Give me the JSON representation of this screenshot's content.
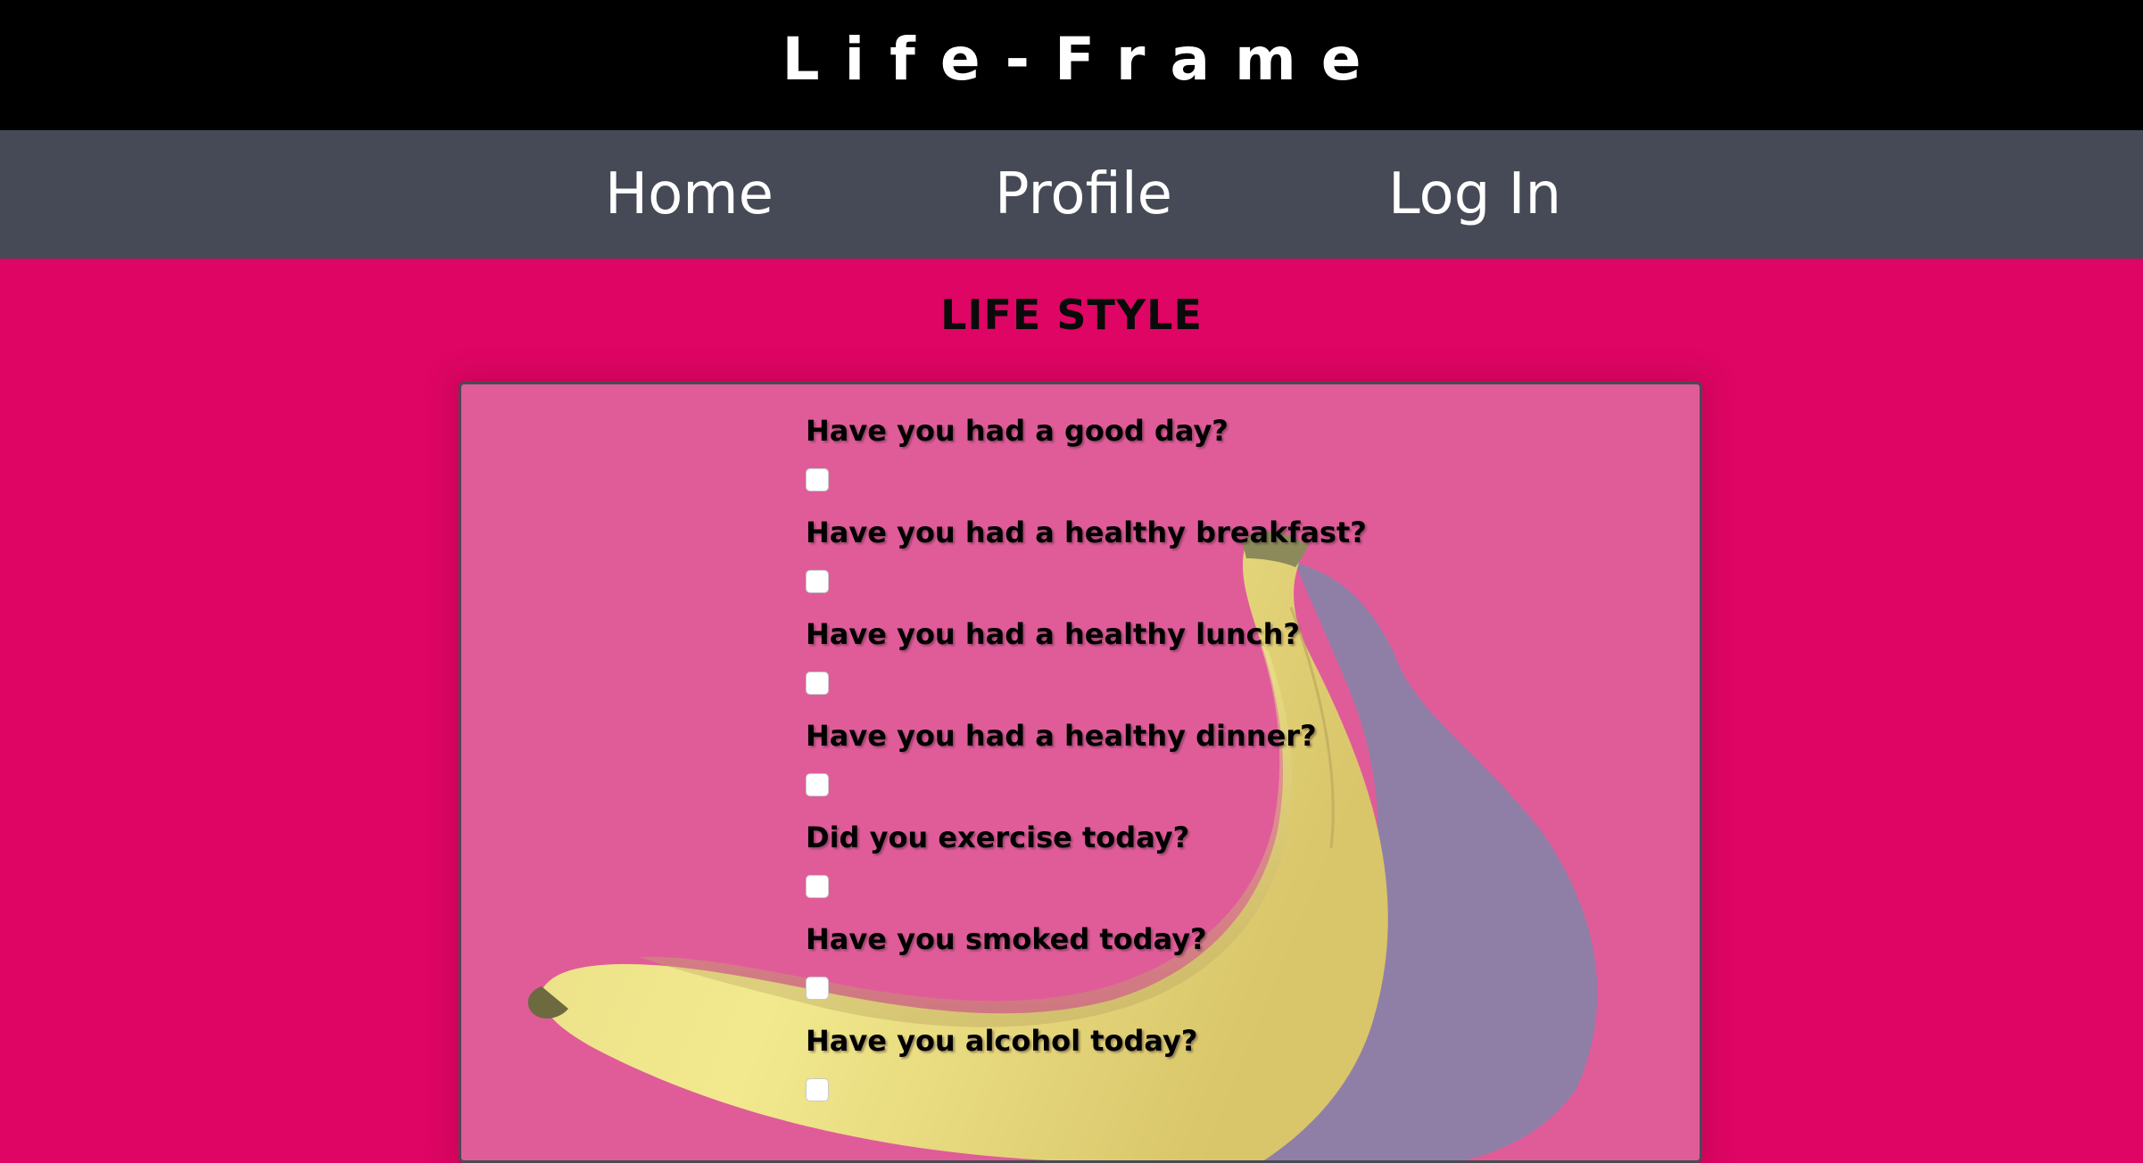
{
  "header": {
    "brand": "Life-Frame"
  },
  "nav": {
    "items": [
      {
        "label": "Home"
      },
      {
        "label": "Profile"
      },
      {
        "label": "Log In"
      }
    ]
  },
  "section": {
    "title": "LIFE STYLE"
  },
  "questions": [
    {
      "label": "Have you had a good day?",
      "checked": false
    },
    {
      "label": "Have you had a healthy breakfast?",
      "checked": false
    },
    {
      "label": "Have you had a healthy lunch?",
      "checked": false
    },
    {
      "label": "Have you had a healthy dinner?",
      "checked": false
    },
    {
      "label": "Did you exercise today?",
      "checked": false
    },
    {
      "label": "Have you smoked today?",
      "checked": false
    },
    {
      "label": "Have you alcohol today?",
      "checked": false
    }
  ],
  "colors": {
    "page_background": "#de0564",
    "top_bar": "#000000",
    "nav_bar": "#464a56",
    "panel_background": "#e05c99"
  }
}
